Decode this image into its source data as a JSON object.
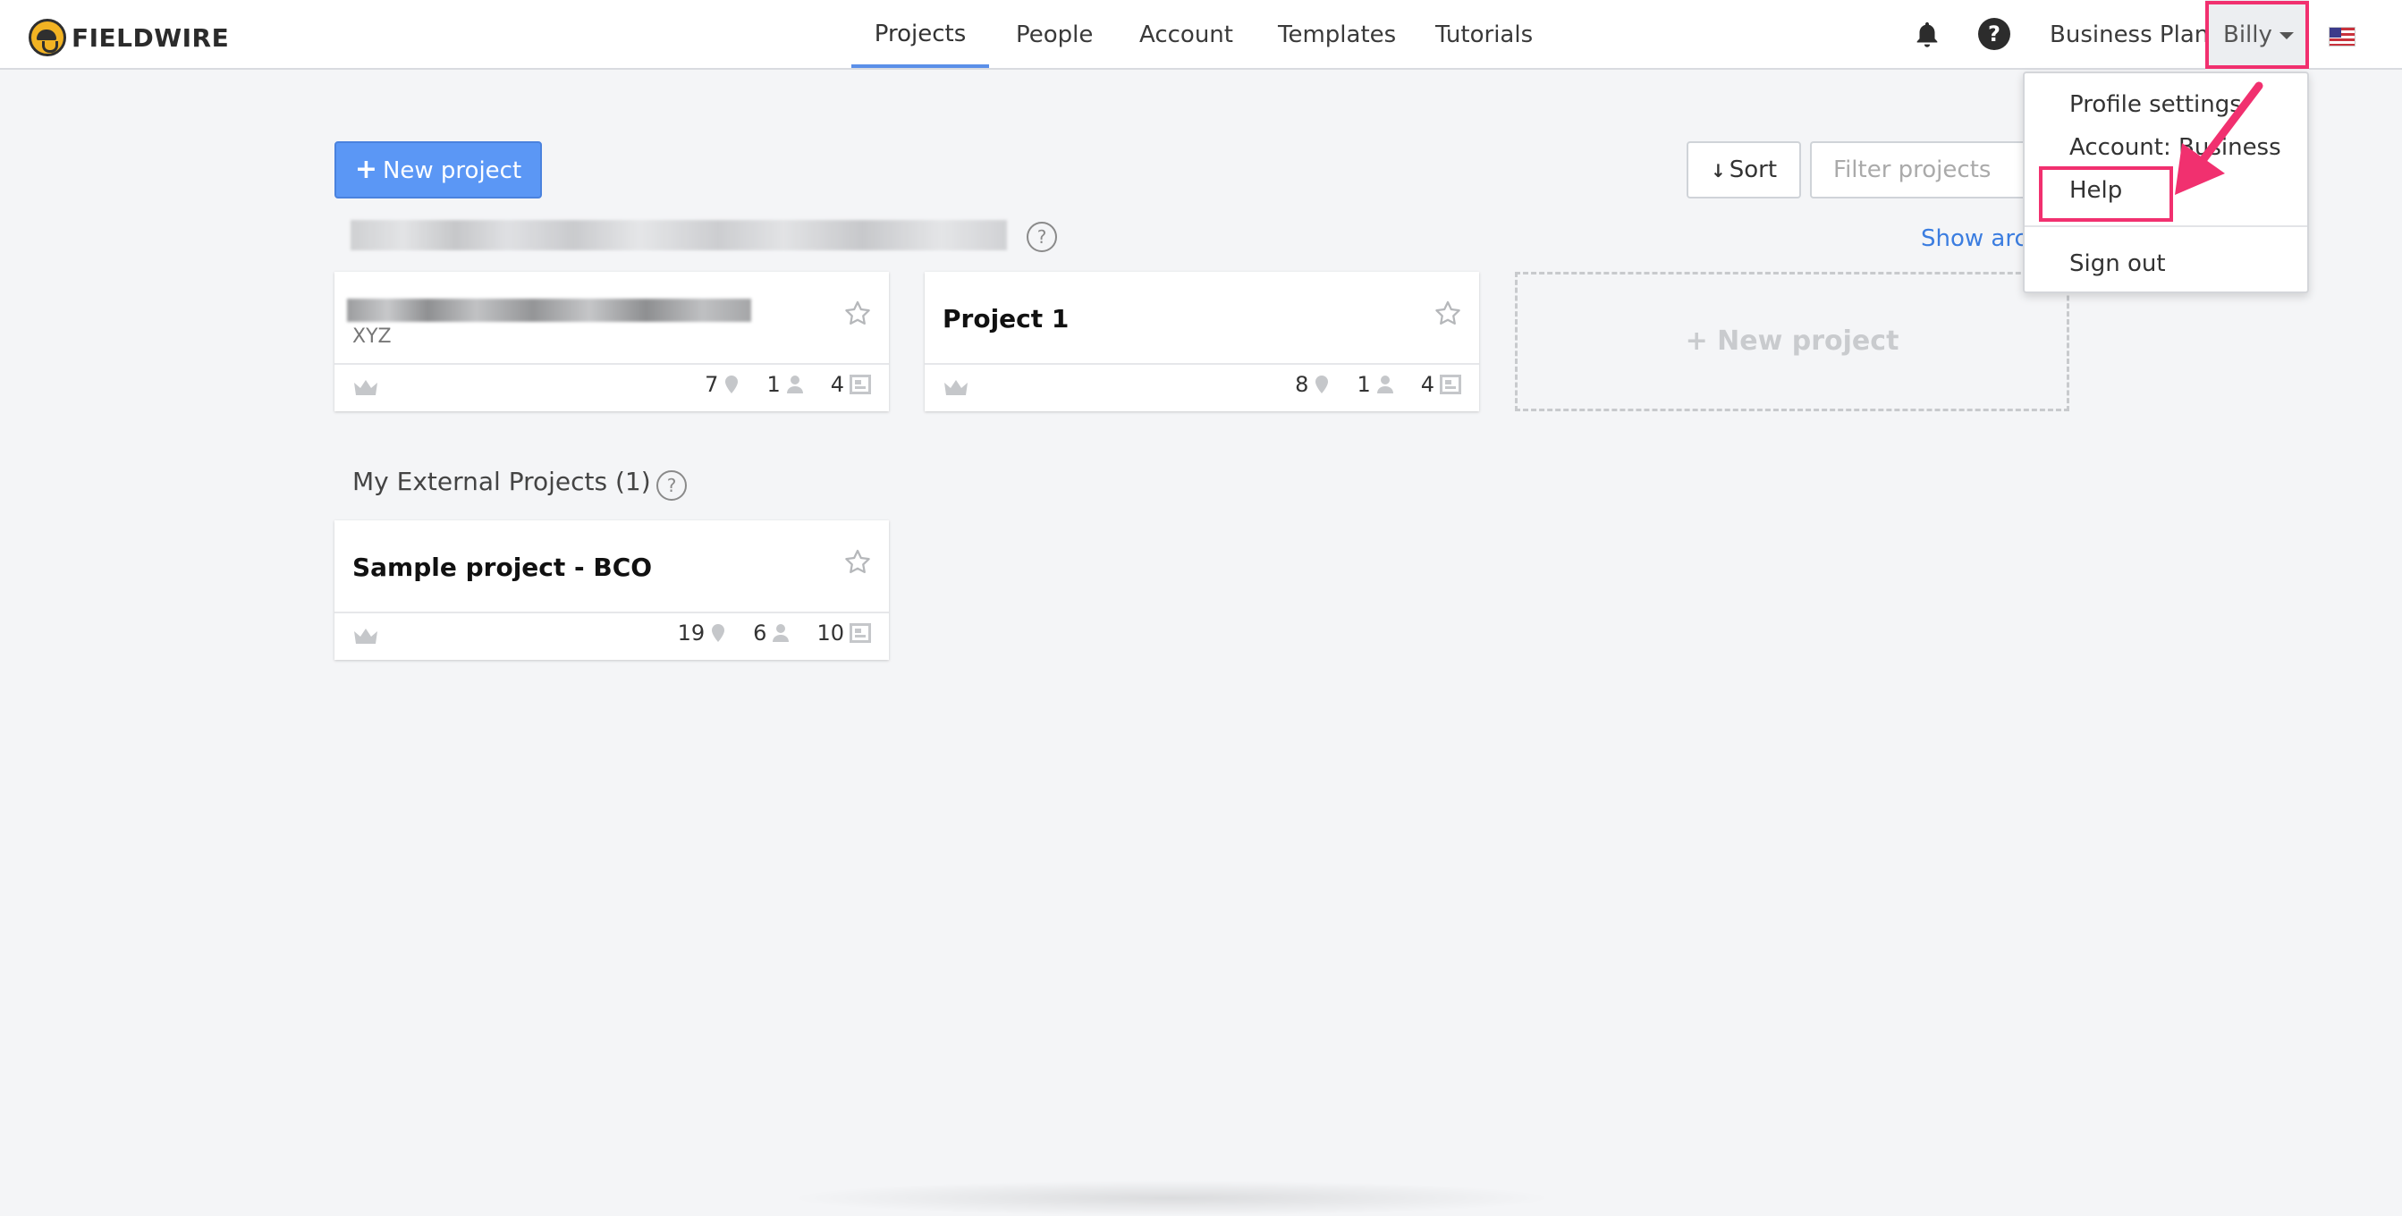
{
  "app": {
    "brand": "FIELDWIRE"
  },
  "nav": {
    "tabs": [
      {
        "label": "Projects",
        "active": true
      },
      {
        "label": "People"
      },
      {
        "label": "Account"
      },
      {
        "label": "Templates"
      },
      {
        "label": "Tutorials"
      }
    ],
    "notification_icon": "bell-icon",
    "help_icon": "question-circle-icon",
    "plan_label": "Business Plan",
    "user_label": "Billy",
    "locale_icon": "us-flag-icon"
  },
  "toolbar": {
    "new_project_label": "New project",
    "sort_label": "Sort",
    "filter_placeholder": "Filter projects"
  },
  "sections": {
    "my_projects": {
      "show_archived_label": "Show arch",
      "projects": [
        {
          "name": "",
          "subtitle": "XYZ",
          "tasks": "7",
          "members": "1",
          "plans": "4"
        },
        {
          "name": "Project 1",
          "tasks": "8",
          "members": "1",
          "plans": "4"
        }
      ],
      "new_project_placeholder": "+ New project"
    },
    "external": {
      "title": "My External Projects (1)",
      "projects": [
        {
          "name": "Sample project - BCO",
          "tasks": "19",
          "members": "6",
          "plans": "10"
        }
      ]
    }
  },
  "user_menu": {
    "items": [
      "Profile settings",
      "Account: Business",
      "Help",
      "Sign out"
    ]
  },
  "colors": {
    "accent": "#5b97f5",
    "link": "#3b7de0",
    "highlight": "#f1306f"
  }
}
